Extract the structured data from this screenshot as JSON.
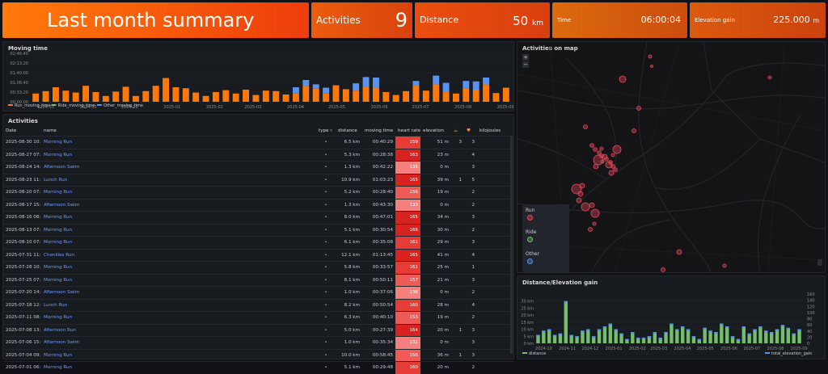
{
  "stats": {
    "title": "Last month summary",
    "activities_label": "Activities",
    "activities_value": "9",
    "distance_label": "Distance",
    "distance_value": "50",
    "distance_unit": "km",
    "time_label": "Time",
    "time_value": "06:00:04",
    "elevation_label": "Elevation gain",
    "elevation_value": "225.000",
    "elevation_unit": "m"
  },
  "moving_time": {
    "title": "Moving time",
    "y_ticks": [
      "02:46:40",
      "02:13:20",
      "01:40:00",
      "01:06:40",
      "00:33:20",
      "00:00:00"
    ],
    "x_ticks": [
      "2024-10",
      "2024-11",
      "2024-12",
      "2025-01",
      "2025-02",
      "2025-03",
      "2025-04",
      "2025-05",
      "2025-06",
      "2025-07",
      "2025-08",
      "2025-09"
    ],
    "legend": [
      "Run_moving_time",
      "Ride_moving_time",
      "Other_moving_time"
    ],
    "colors": {
      "run": "#ff780a",
      "ride": "#73bf69",
      "other": "#5794f2"
    }
  },
  "chart_data": [
    {
      "type": "bar",
      "title": "Moving time",
      "x_range": [
        "2024-09-20",
        "2025-09-05"
      ],
      "ylim": [
        0,
        10000
      ],
      "y_unit": "seconds",
      "series": [
        {
          "name": "Run_moving_time",
          "values": [
            1700,
            2200,
            3000,
            2300,
            1900,
            3300,
            2000,
            1200,
            2100,
            3100,
            1200,
            2200,
            3300,
            4900,
            3000,
            2800,
            1900,
            1200,
            2000,
            2400,
            1700,
            2500,
            1400,
            2300,
            2200,
            1500,
            1700,
            3300,
            2700,
            1700,
            3400,
            2600,
            2300,
            3100,
            2900,
            2000,
            1400,
            2200,
            3400,
            2300,
            3600,
            2100,
            1700,
            2800,
            2500,
            3600,
            1800,
            2900
          ]
        },
        {
          "name": "Other_moving_time",
          "values": [
            0,
            0,
            0,
            0,
            0,
            0,
            0,
            0,
            0,
            0,
            0,
            0,
            0,
            0,
            0,
            0,
            0,
            0,
            0,
            0,
            0,
            0,
            0,
            0,
            0,
            0,
            1300,
            1200,
            900,
            1200,
            0,
            0,
            1500,
            2000,
            2100,
            0,
            0,
            0,
            900,
            0,
            1800,
            1800,
            0,
            1500,
            1700,
            1400,
            0,
            0
          ]
        }
      ]
    },
    {
      "type": "bar",
      "title": "Distance/Elevation gain",
      "x_range": [
        "2024-09-20",
        "2025-09-05"
      ],
      "ylim": [
        0,
        35
      ],
      "y_unit": "km",
      "y2lim": [
        0,
        160
      ],
      "series": [
        {
          "name": "distance",
          "values": [
            6,
            9,
            10,
            6,
            7,
            30,
            6,
            5,
            9,
            10,
            5,
            10,
            12,
            14,
            10,
            7,
            3,
            8,
            4,
            4,
            5,
            8,
            4,
            8,
            14,
            10,
            12,
            10,
            5,
            3,
            11,
            9,
            8,
            14,
            12,
            5,
            3,
            12,
            7,
            10,
            12,
            9,
            8,
            10,
            13,
            11,
            7,
            10
          ]
        },
        {
          "name": "total_elevation_gain",
          "values": [
            40,
            45,
            60,
            40,
            45,
            150,
            35,
            30,
            50,
            55,
            40,
            50,
            55,
            70,
            50,
            40,
            20,
            45,
            25,
            25,
            30,
            40,
            25,
            50,
            65,
            55,
            60,
            55,
            30,
            20,
            55,
            45,
            40,
            70,
            60,
            30,
            20,
            60,
            40,
            50,
            60,
            50,
            40,
            50,
            65,
            55,
            40,
            50
          ]
        }
      ]
    }
  ],
  "activities": {
    "title": "Activities",
    "columns": [
      "Date",
      "name",
      "type",
      "distance",
      "moving time",
      "heart rate",
      "elevation",
      "☕",
      "♥",
      "kilojoules"
    ],
    "rows": [
      {
        "date": "2025-08-30 10:",
        "name": "Morning Run",
        "type": "•",
        "distance": "6.5 km",
        "time": "00:40:29",
        "hr": "159",
        "elev": "51 m",
        "a": "3",
        "b": "3"
      },
      {
        "date": "2025-08-27 07:",
        "name": "Morning Run",
        "type": "•",
        "distance": "5.3 km",
        "time": "00:28:38",
        "hr": "163",
        "elev": "23 m",
        "a": "",
        "b": "4"
      },
      {
        "date": "2025-08-24 14:",
        "name": "Afternoon Swim",
        "type": "•",
        "distance": "1.3 km",
        "time": "00:42:22",
        "hr": "135",
        "elev": "0 m",
        "a": "",
        "b": "3"
      },
      {
        "date": "2025-08-23 11:",
        "name": "Lunch Run",
        "type": "•",
        "distance": "10.9 km",
        "time": "01:03:23",
        "hr": "165",
        "elev": "39 m",
        "a": "1",
        "b": "5"
      },
      {
        "date": "2025-08-20 07:",
        "name": "Morning Run",
        "type": "•",
        "distance": "5.2 km",
        "time": "00:28:40",
        "hr": "156",
        "elev": "19 m",
        "a": "",
        "b": "2"
      },
      {
        "date": "2025-08-17 15:",
        "name": "Afternoon Swim",
        "type": "•",
        "distance": "1.3 km",
        "time": "00:43:30",
        "hr": "133",
        "elev": "0 m",
        "a": "",
        "b": "2"
      },
      {
        "date": "2025-08-16 08:",
        "name": "Morning Run",
        "type": "•",
        "distance": "8.0 km",
        "time": "00:47:01",
        "hr": "165",
        "elev": "34 m",
        "a": "",
        "b": "3"
      },
      {
        "date": "2025-08-13 07:",
        "name": "Morning Run",
        "type": "•",
        "distance": "5.1 km",
        "time": "00:30:54",
        "hr": "166",
        "elev": "30 m",
        "a": "",
        "b": "2"
      },
      {
        "date": "2025-08-10 07:",
        "name": "Morning Run",
        "type": "•",
        "distance": "6.1 km",
        "time": "00:35:08",
        "hr": "161",
        "elev": "29 m",
        "a": "",
        "b": "3"
      },
      {
        "date": "2025-07-31 11:",
        "name": "Chenilles Run",
        "type": "•",
        "distance": "12.1 km",
        "time": "01:13:45",
        "hr": "165",
        "elev": "41 m",
        "a": "",
        "b": "4"
      },
      {
        "date": "2025-07-28 10:",
        "name": "Morning Run",
        "type": "•",
        "distance": "5.8 km",
        "time": "00:33:57",
        "hr": "161",
        "elev": "25 m",
        "a": "",
        "b": "1"
      },
      {
        "date": "2025-07-25 07:",
        "name": "Morning Run",
        "type": "•",
        "distance": "8.1 km",
        "time": "00:50:11",
        "hr": "157",
        "elev": "21 m",
        "a": "",
        "b": "3"
      },
      {
        "date": "2025-07-20 14:",
        "name": "Afternoon Swim",
        "type": "•",
        "distance": "1.0 km",
        "time": "00:37:06",
        "hr": "136",
        "elev": "0 m",
        "a": "",
        "b": "2"
      },
      {
        "date": "2025-07-18 12:",
        "name": "Lunch Run",
        "type": "•",
        "distance": "8.2 km",
        "time": "00:50:54",
        "hr": "160",
        "elev": "28 m",
        "a": "",
        "b": "4"
      },
      {
        "date": "2025-07-11 08:",
        "name": "Morning Run",
        "type": "•",
        "distance": "6.3 km",
        "time": "00:40:10",
        "hr": "153",
        "elev": "19 m",
        "a": "",
        "b": "2"
      },
      {
        "date": "2025-07-08 13:",
        "name": "Afternoon Run",
        "type": "•",
        "distance": "5.0 km",
        "time": "00:27:39",
        "hr": "164",
        "elev": "20 m",
        "a": "1",
        "b": "3"
      },
      {
        "date": "2025-07-06 15:",
        "name": "Afternoon Swim",
        "type": "•",
        "distance": "1.0 km",
        "time": "00:35:34",
        "hr": "132",
        "elev": "0 m",
        "a": "",
        "b": "3"
      },
      {
        "date": "2025-07-04 09:",
        "name": "Morning Run",
        "type": "•",
        "distance": "10.0 km",
        "time": "00:58:45",
        "hr": "156",
        "elev": "36 m",
        "a": "1",
        "b": "3"
      },
      {
        "date": "2025-07-01 06:",
        "name": "Morning Run",
        "type": "•",
        "distance": "5.1 km",
        "time": "00:29:48",
        "hr": "160",
        "elev": "20 m",
        "a": "",
        "b": "2"
      }
    ]
  },
  "map": {
    "title": "Activities on map",
    "zoom_in": "+",
    "zoom_out": "−",
    "legend": [
      {
        "label": "Run",
        "color": "#f2495c"
      },
      {
        "label": "Ride",
        "color": "#73bf69"
      },
      {
        "label": "Other",
        "color": "#5794f2"
      }
    ]
  },
  "dist_elev": {
    "title": "Distance/Elevation gain",
    "y_ticks": [
      "30 km",
      "25 km",
      "20 km",
      "15 km",
      "10 km",
      "5 km",
      "0 km"
    ],
    "y2_ticks": [
      "160",
      "140",
      "120",
      "100",
      "80",
      "60",
      "40",
      "20",
      "0"
    ],
    "x_ticks": [
      "2024-10",
      "2024-11",
      "2024-12",
      "2025-01",
      "2025-02",
      "2025-03",
      "2025-04",
      "2025-05",
      "2025-06",
      "2025-07",
      "2025-08",
      "2025-09"
    ],
    "legend": [
      "distance",
      "total_elevation_gain"
    ],
    "colors": {
      "distance": "#73bf69",
      "elevation": "#5794f2"
    }
  }
}
